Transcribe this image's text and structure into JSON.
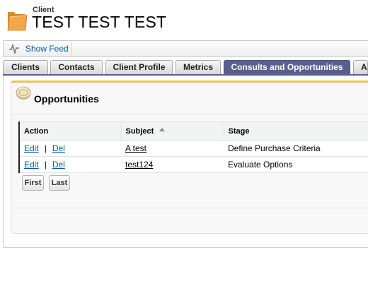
{
  "header": {
    "object_type": "Client",
    "record_title": "TEST TEST TEST",
    "icon": "folder-icon"
  },
  "feed": {
    "label": "Show Feed",
    "icon": "feed-icon"
  },
  "tabs": [
    {
      "label": "Clients",
      "active": false
    },
    {
      "label": "Contacts",
      "active": false
    },
    {
      "label": "Client Profile",
      "active": false
    },
    {
      "label": "Metrics",
      "active": false
    },
    {
      "label": "Consults and Opportunities",
      "active": true
    },
    {
      "label": "Ac",
      "active": false
    }
  ],
  "related_list": {
    "title": "Opportunities",
    "icon": "coin-icon",
    "columns": [
      "Action",
      "Subject",
      "Stage"
    ],
    "sorted_column": "Subject",
    "rows": [
      {
        "edit": "Edit",
        "separator": "|",
        "del": "Del",
        "subject": "A test",
        "stage": "Define Purchase Criteria"
      },
      {
        "edit": "Edit",
        "separator": "|",
        "del": "Del",
        "subject": "test124",
        "stage": "Evaluate Options"
      }
    ],
    "pagination": {
      "first": "First",
      "last": "Last"
    }
  },
  "colors": {
    "active_tab": "#5a5f8f",
    "accent_border": "#e8c44b",
    "link": "#015ba7"
  }
}
